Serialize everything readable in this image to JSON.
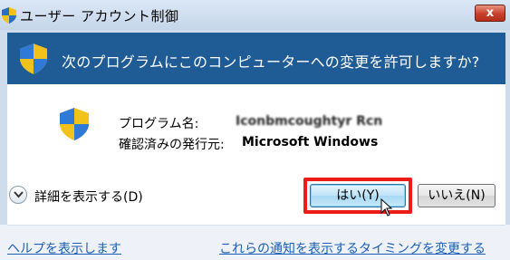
{
  "window": {
    "title": "ユーザー アカウント制御",
    "close_label": "x"
  },
  "banner": {
    "message": "次のプログラムにこのコンピューターへの変更を許可しますか?"
  },
  "details": {
    "program_label": "プログラム名:",
    "program_value": "Iconbmcoughtyr Rcn",
    "publisher_label": "確認済みの発行元:",
    "publisher_value": "Microsoft Windows"
  },
  "actions": {
    "details_toggle": "詳細を表示する(D)",
    "yes_label": "はい(Y)",
    "no_label": "いいえ(N)"
  },
  "footer": {
    "help_link": "ヘルプを表示します",
    "notify_link": "これらの通知を表示するタイミングを変更する"
  },
  "colors": {
    "banner": "#1f5b94",
    "highlight": "#ee1b1b",
    "link": "#1a5fb4"
  }
}
